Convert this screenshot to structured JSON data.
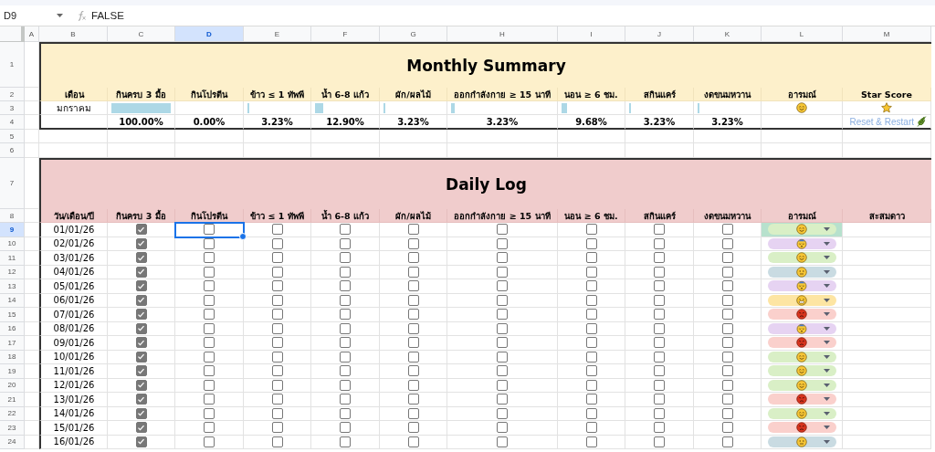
{
  "formula_bar": {
    "cell_ref": "D9",
    "formula": "FALSE"
  },
  "column_headers": [
    {
      "label": "A",
      "selected": false
    },
    {
      "label": "B",
      "selected": false
    },
    {
      "label": "C",
      "selected": false
    },
    {
      "label": "D",
      "selected": true
    },
    {
      "label": "E",
      "selected": false
    },
    {
      "label": "F",
      "selected": false
    },
    {
      "label": "G",
      "selected": false
    },
    {
      "label": "H",
      "selected": false
    },
    {
      "label": "I",
      "selected": false
    },
    {
      "label": "J",
      "selected": false
    },
    {
      "label": "K",
      "selected": false
    },
    {
      "label": "L",
      "selected": false
    },
    {
      "label": "M",
      "selected": false
    }
  ],
  "row_headers": [
    {
      "label": "1",
      "selected": false
    },
    {
      "label": "2",
      "selected": false
    },
    {
      "label": "3",
      "selected": false
    },
    {
      "label": "4",
      "selected": false
    },
    {
      "label": "5",
      "selected": false
    },
    {
      "label": "6",
      "selected": false
    },
    {
      "label": "7",
      "selected": false
    },
    {
      "label": "8",
      "selected": false
    },
    {
      "label": "9",
      "selected": true
    },
    {
      "label": "10",
      "selected": false
    },
    {
      "label": "11",
      "selected": false
    },
    {
      "label": "12",
      "selected": false
    },
    {
      "label": "13",
      "selected": false
    },
    {
      "label": "14",
      "selected": false
    },
    {
      "label": "15",
      "selected": false
    },
    {
      "label": "16",
      "selected": false
    },
    {
      "label": "17",
      "selected": false
    },
    {
      "label": "18",
      "selected": false
    },
    {
      "label": "19",
      "selected": false
    },
    {
      "label": "20",
      "selected": false
    },
    {
      "label": "21",
      "selected": false
    },
    {
      "label": "22",
      "selected": false
    },
    {
      "label": "23",
      "selected": false
    },
    {
      "label": "24",
      "selected": false
    }
  ],
  "monthly_summary": {
    "title": "Monthly Summary",
    "headings": [
      "เดือน",
      "กินครบ 3 มื้อ",
      "กินโปรตีน",
      "ข้าว ≤ 1 ทัพพี",
      "น้ำ 6-8 แก้ว",
      "ผัก/ผลไม้",
      "ออกกำลังกาย ≥ 15 นาที",
      "นอน ≥ 6 ชม.",
      "สกินแคร์",
      "งดขนมหวาน",
      "อารมณ์",
      "Star Score"
    ],
    "month": "มกราคม",
    "metrics": [
      {
        "level": 1,
        "percentage": "100.00%"
      },
      {
        "percentage": "0.00%"
      },
      {
        "level": 0.032,
        "percentage": "3.23%"
      },
      {
        "level": 0.129,
        "percentage": "12.90%"
      },
      {
        "level": 0.032,
        "percentage": "3.23%"
      },
      {
        "level": 0.032,
        "percentage": "3.23%"
      },
      {
        "level": 0.097,
        "percentage": "9.68%"
      },
      {
        "level": 0.032,
        "percentage": "3.23%"
      },
      {
        "level": 0.032,
        "percentage": "3.23%"
      }
    ],
    "mood": {
      "kind": "happy"
    },
    "reset_link": "Reset & Restart"
  },
  "daily_log": {
    "title": "Daily Log",
    "headings": [
      "วัน/เดือน/ปี",
      "กินครบ 3 มื้อ",
      "กินโปรตีน",
      "ข้าว ≤ 1 ทัพพี",
      "น้ำ 6-8 แก้ว",
      "ผัก/ผลไม้",
      "ออกกำลังกาย ≥ 15 นาที",
      "นอน ≥ 6 ชม.",
      "สกินแคร์",
      "งดขนมหวาน",
      "อารมณ์",
      "สะสมดาว"
    ],
    "rows": [
      {
        "date": "01/01/26",
        "checks": [
          true,
          false,
          false,
          false,
          false,
          false,
          false,
          false,
          false
        ],
        "mood": {
          "kind": "happy",
          "color": "#d9efc6"
        },
        "highlighted": true
      },
      {
        "date": "02/01/26",
        "checks": [
          true,
          false,
          false,
          false,
          false,
          false,
          false,
          false,
          false
        ],
        "mood": {
          "kind": "sleepy",
          "color": "#e6d3f2"
        },
        "highlighted": false
      },
      {
        "date": "03/01/26",
        "checks": [
          true,
          false,
          false,
          false,
          false,
          false,
          false,
          false,
          false
        ],
        "mood": {
          "kind": "happy",
          "color": "#d9efc6"
        },
        "highlighted": false
      },
      {
        "date": "04/01/26",
        "checks": [
          true,
          false,
          false,
          false,
          false,
          false,
          false,
          false,
          false
        ],
        "mood": {
          "kind": "neutral",
          "color": "#c9dbe2"
        },
        "highlighted": false
      },
      {
        "date": "05/01/26",
        "checks": [
          true,
          false,
          false,
          false,
          false,
          false,
          false,
          false,
          false
        ],
        "mood": {
          "kind": "sleepy",
          "color": "#e6d3f2"
        },
        "highlighted": false
      },
      {
        "date": "06/01/26",
        "checks": [
          true,
          false,
          false,
          false,
          false,
          false,
          false,
          false,
          false
        ],
        "mood": {
          "kind": "grimace",
          "color": "#fde5a3"
        },
        "highlighted": false
      },
      {
        "date": "07/01/26",
        "checks": [
          true,
          false,
          false,
          false,
          false,
          false,
          false,
          false,
          false
        ],
        "mood": {
          "kind": "angry",
          "color": "#fad0cc"
        },
        "highlighted": false
      },
      {
        "date": "08/01/26",
        "checks": [
          true,
          false,
          false,
          false,
          false,
          false,
          false,
          false,
          false
        ],
        "mood": {
          "kind": "sleepy",
          "color": "#e6d3f2"
        },
        "highlighted": false
      },
      {
        "date": "09/01/26",
        "checks": [
          true,
          false,
          false,
          false,
          false,
          false,
          false,
          false,
          false
        ],
        "mood": {
          "kind": "angry",
          "color": "#fad0cc"
        },
        "highlighted": false
      },
      {
        "date": "10/01/26",
        "checks": [
          true,
          false,
          false,
          false,
          false,
          false,
          false,
          false,
          false
        ],
        "mood": {
          "kind": "happy",
          "color": "#d9efc6"
        },
        "highlighted": false
      },
      {
        "date": "11/01/26",
        "checks": [
          true,
          false,
          false,
          false,
          false,
          false,
          false,
          false,
          false
        ],
        "mood": {
          "kind": "happy",
          "color": "#d9efc6"
        },
        "highlighted": false
      },
      {
        "date": "12/01/26",
        "checks": [
          true,
          false,
          false,
          false,
          false,
          false,
          false,
          false,
          false
        ],
        "mood": {
          "kind": "happy",
          "color": "#d9efc6"
        },
        "highlighted": false
      },
      {
        "date": "13/01/26",
        "checks": [
          true,
          false,
          false,
          false,
          false,
          false,
          false,
          false,
          false
        ],
        "mood": {
          "kind": "angry",
          "color": "#fad0cc"
        },
        "highlighted": false
      },
      {
        "date": "14/01/26",
        "checks": [
          true,
          false,
          false,
          false,
          false,
          false,
          false,
          false,
          false
        ],
        "mood": {
          "kind": "happy",
          "color": "#d9efc6"
        },
        "highlighted": false
      },
      {
        "date": "15/01/26",
        "checks": [
          true,
          false,
          false,
          false,
          false,
          false,
          false,
          false,
          false
        ],
        "mood": {
          "kind": "angry",
          "color": "#fad0cc"
        },
        "highlighted": false
      },
      {
        "date": "16/01/26",
        "checks": [
          true,
          false,
          false,
          false,
          false,
          false,
          false,
          false,
          false
        ],
        "mood": {
          "kind": "neutral",
          "color": "#c9dbe2"
        },
        "highlighted": false
      }
    ]
  }
}
